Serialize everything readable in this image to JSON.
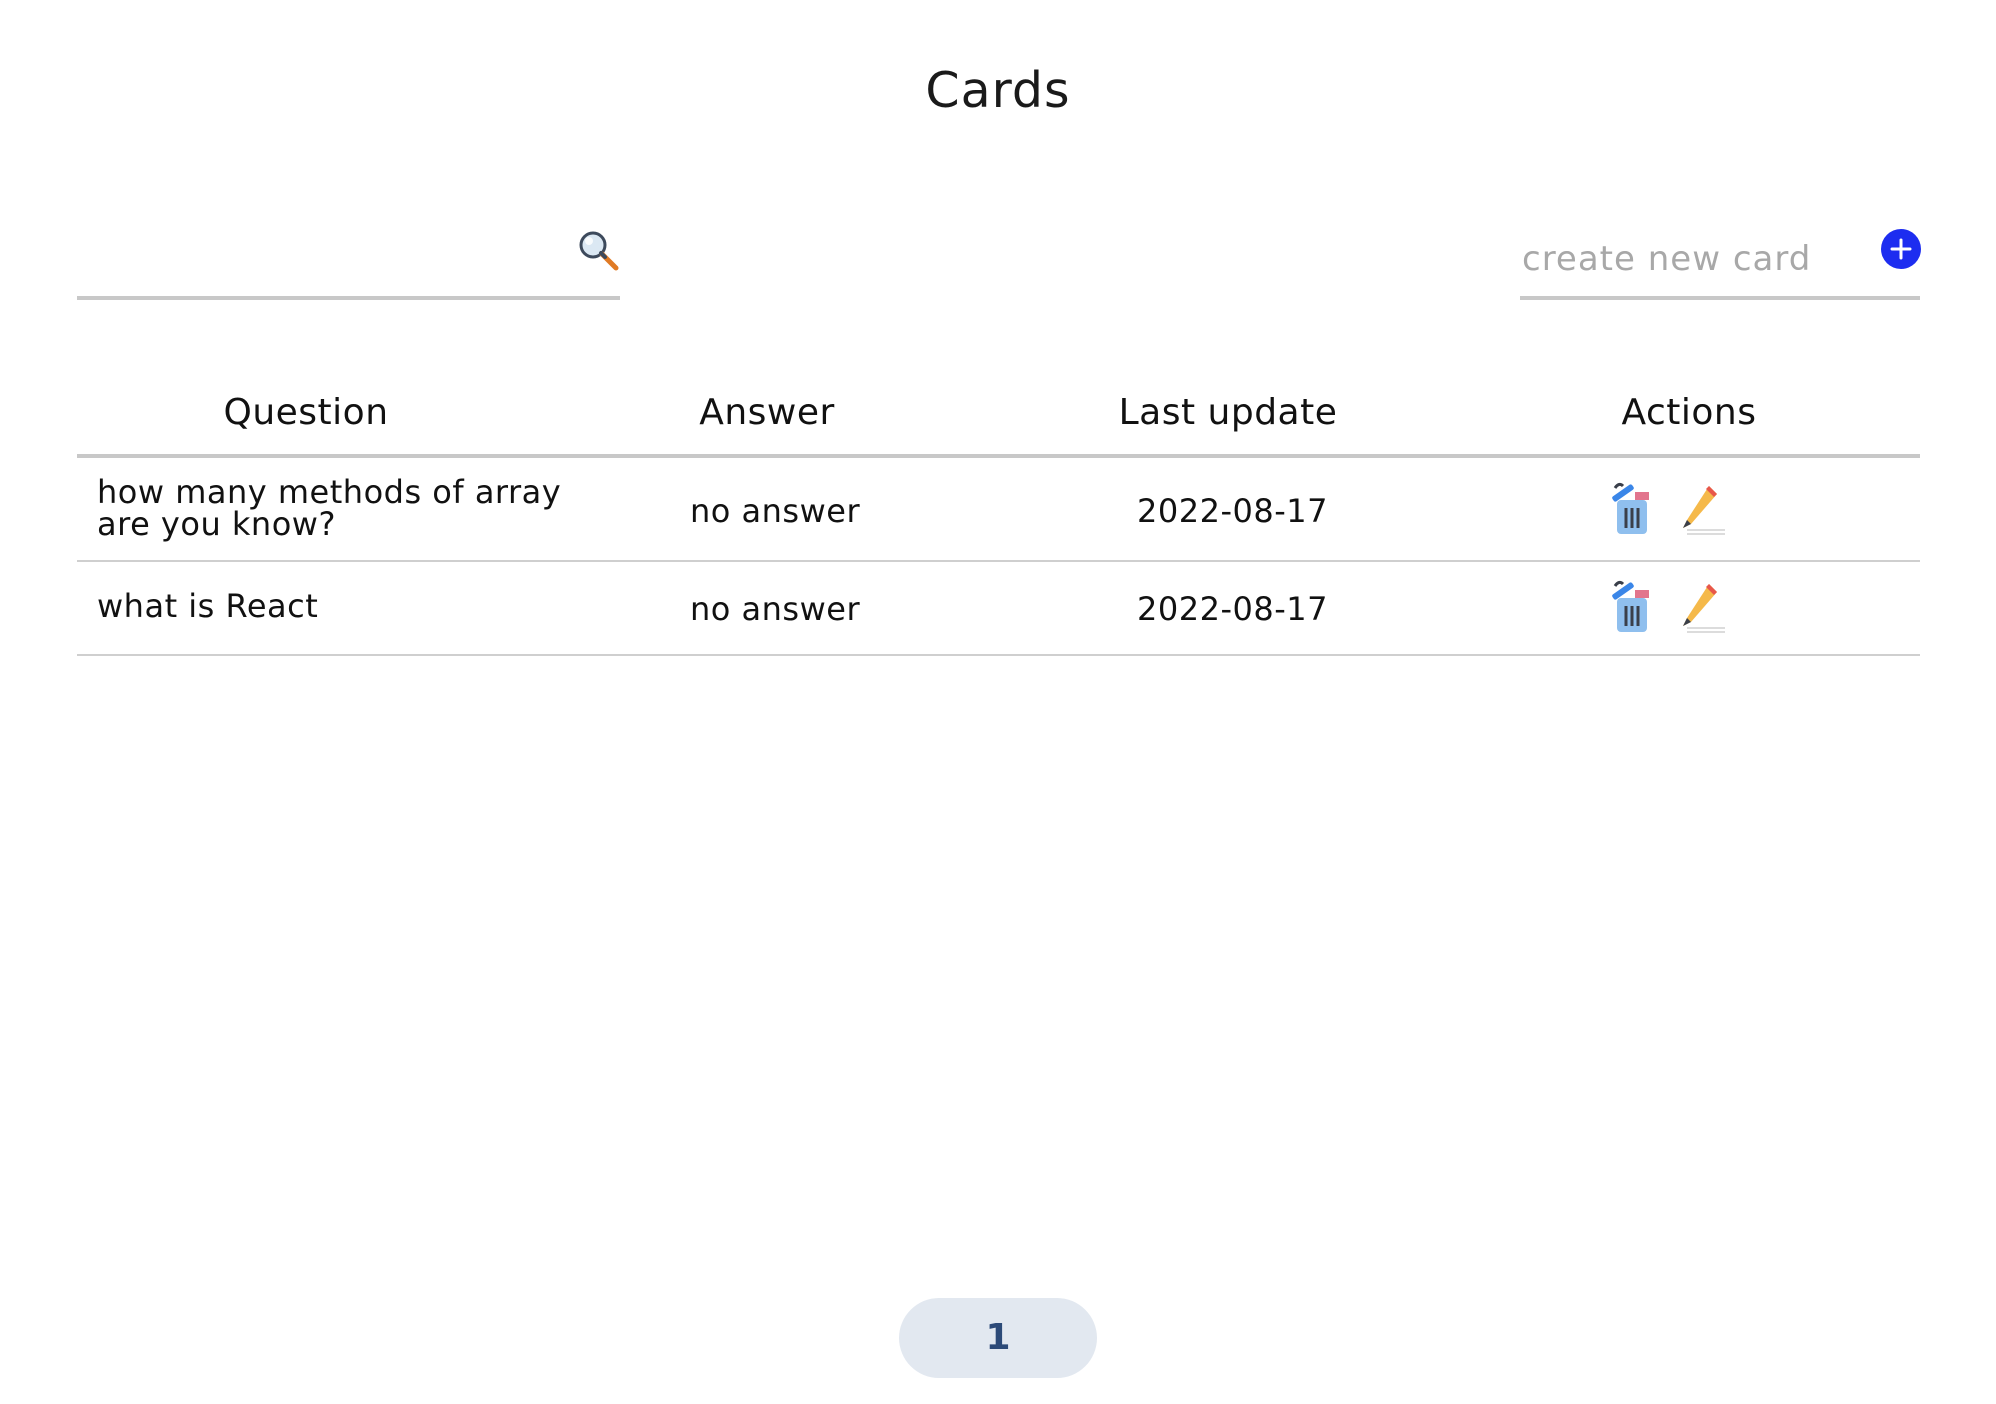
{
  "page": {
    "title": "Cards"
  },
  "search": {
    "value": "",
    "icon": "magnifier-icon"
  },
  "create": {
    "placeholder": "create new card",
    "value": "",
    "button_icon": "plus-icon",
    "button_color": "#1d2df0"
  },
  "table": {
    "headers": [
      "Question",
      "Answer",
      "Last update",
      "Actions"
    ],
    "rows": [
      {
        "question_line1": "how many methods of array",
        "question_line2": "are you know?",
        "answer": "no answer",
        "last_update": "2022-08-17",
        "actions": [
          "trash-icon",
          "pencil-icon"
        ]
      },
      {
        "question_line1": "what is React",
        "answer": "no answer",
        "last_update": "2022-08-17",
        "actions": [
          "trash-icon",
          "pencil-icon"
        ]
      }
    ]
  },
  "pagination": {
    "current_page": "1",
    "background": "#e2e8f0",
    "text_color": "#2c4a78"
  }
}
